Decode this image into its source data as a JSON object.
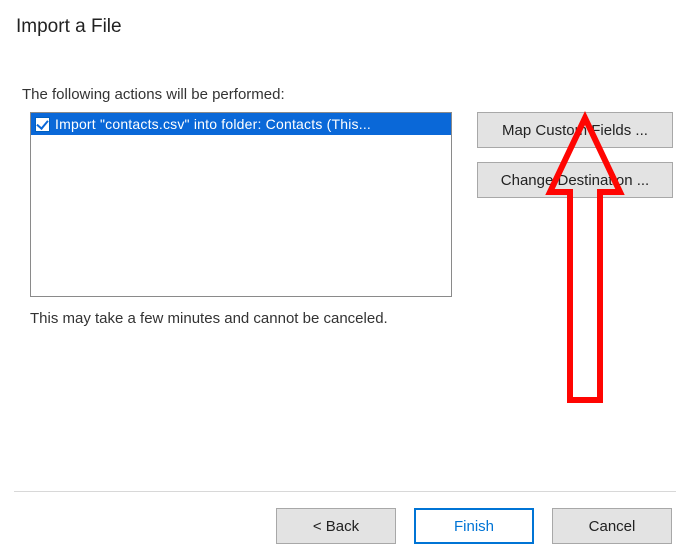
{
  "dialog": {
    "title": "Import a File",
    "subtitle": "The following actions will be performed:",
    "note": "This may take a few minutes and cannot be canceled."
  },
  "actions_list": {
    "items": [
      {
        "checked": true,
        "label": "Import \"contacts.csv\" into folder: Contacts (This..."
      }
    ]
  },
  "side_buttons": {
    "map_custom_fields": "Map Custom Fields ...",
    "change_destination": "Change Destination ..."
  },
  "footer": {
    "back": "< Back",
    "finish": "Finish",
    "cancel": "Cancel"
  },
  "annotation": {
    "arrow_color": "#ff0502"
  }
}
